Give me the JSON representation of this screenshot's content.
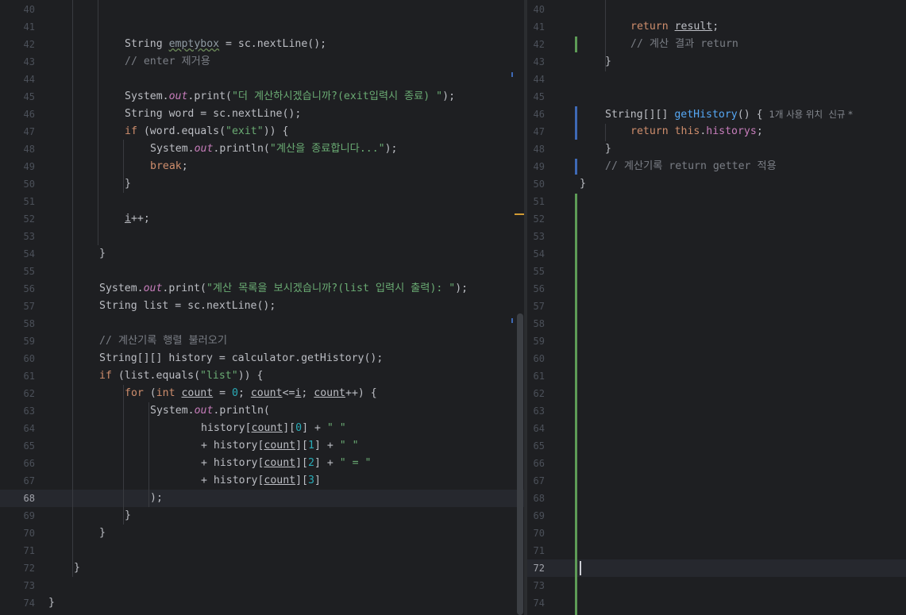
{
  "left_editor": {
    "current_line": 68,
    "lines": [
      {
        "n": 40,
        "tokens": []
      },
      {
        "n": 41,
        "tokens": []
      },
      {
        "n": 42,
        "tokens": [
          {
            "t": "String ",
            "c": ""
          },
          {
            "t": "emptybox",
            "c": "wv"
          },
          {
            "t": " = sc.nextLine();",
            "c": ""
          }
        ],
        "indent": 3
      },
      {
        "n": 43,
        "tokens": [
          {
            "t": "// enter 제거용",
            "c": "cm"
          }
        ],
        "indent": 3
      },
      {
        "n": 44,
        "tokens": []
      },
      {
        "n": 45,
        "tokens": [
          {
            "t": "System.",
            "c": ""
          },
          {
            "t": "out",
            "c": "fld"
          },
          {
            "t": ".print(",
            "c": ""
          },
          {
            "t": "\"더 계산하시겠습니까?(exit입력시 종료) \"",
            "c": "st"
          },
          {
            "t": ");",
            "c": ""
          }
        ],
        "indent": 3
      },
      {
        "n": 46,
        "tokens": [
          {
            "t": "String word = sc.nextLine();",
            "c": ""
          }
        ],
        "indent": 3
      },
      {
        "n": 47,
        "tokens": [
          {
            "t": "if ",
            "c": "kw"
          },
          {
            "t": "(word.equals(",
            "c": ""
          },
          {
            "t": "\"exit\"",
            "c": "st"
          },
          {
            "t": ")) {",
            "c": ""
          }
        ],
        "indent": 3
      },
      {
        "n": 48,
        "tokens": [
          {
            "t": "System.",
            "c": ""
          },
          {
            "t": "out",
            "c": "fld"
          },
          {
            "t": ".println(",
            "c": ""
          },
          {
            "t": "\"계산을 종료합니다...\"",
            "c": "st"
          },
          {
            "t": ");",
            "c": ""
          }
        ],
        "indent": 4
      },
      {
        "n": 49,
        "tokens": [
          {
            "t": "break",
            "c": "kw"
          },
          {
            "t": ";",
            "c": ""
          }
        ],
        "indent": 4
      },
      {
        "n": 50,
        "tokens": [
          {
            "t": "}",
            "c": ""
          }
        ],
        "indent": 3
      },
      {
        "n": 51,
        "tokens": []
      },
      {
        "n": 52,
        "tokens": [
          {
            "t": "i",
            "c": "ul"
          },
          {
            "t": "++;",
            "c": ""
          }
        ],
        "indent": 3
      },
      {
        "n": 53,
        "tokens": []
      },
      {
        "n": 54,
        "tokens": [
          {
            "t": "}",
            "c": ""
          }
        ],
        "indent": 2
      },
      {
        "n": 55,
        "tokens": []
      },
      {
        "n": 56,
        "tokens": [
          {
            "t": "System.",
            "c": ""
          },
          {
            "t": "out",
            "c": "fld"
          },
          {
            "t": ".print(",
            "c": ""
          },
          {
            "t": "\"계산 목록을 보시겠습니까?(list 입력시 출력): \"",
            "c": "st"
          },
          {
            "t": ");",
            "c": ""
          }
        ],
        "indent": 2
      },
      {
        "n": 57,
        "tokens": [
          {
            "t": "String list = sc.nextLine();",
            "c": ""
          }
        ],
        "indent": 2
      },
      {
        "n": 58,
        "tokens": []
      },
      {
        "n": 59,
        "tokens": [
          {
            "t": "// 계산기록 행렬 불러오기",
            "c": "cm"
          }
        ],
        "indent": 2
      },
      {
        "n": 60,
        "tokens": [
          {
            "t": "String[][] history = calculator.getHistory();",
            "c": ""
          }
        ],
        "indent": 2
      },
      {
        "n": 61,
        "tokens": [
          {
            "t": "if ",
            "c": "kw"
          },
          {
            "t": "(list.equals(",
            "c": ""
          },
          {
            "t": "\"list\"",
            "c": "st"
          },
          {
            "t": ")) {",
            "c": ""
          }
        ],
        "indent": 2
      },
      {
        "n": 62,
        "tokens": [
          {
            "t": "for ",
            "c": "kw"
          },
          {
            "t": "(",
            "c": ""
          },
          {
            "t": "int ",
            "c": "kw"
          },
          {
            "t": "count",
            "c": "ul"
          },
          {
            "t": " = ",
            "c": ""
          },
          {
            "t": "0",
            "c": "num"
          },
          {
            "t": "; ",
            "c": ""
          },
          {
            "t": "count",
            "c": "ul"
          },
          {
            "t": "<=",
            "c": ""
          },
          {
            "t": "i",
            "c": "ul"
          },
          {
            "t": "; ",
            "c": ""
          },
          {
            "t": "count",
            "c": "ul"
          },
          {
            "t": "++) {",
            "c": ""
          }
        ],
        "indent": 3
      },
      {
        "n": 63,
        "tokens": [
          {
            "t": "System.",
            "c": ""
          },
          {
            "t": "out",
            "c": "fld"
          },
          {
            "t": ".println(",
            "c": ""
          }
        ],
        "indent": 4
      },
      {
        "n": 64,
        "tokens": [
          {
            "t": "history[",
            "c": ""
          },
          {
            "t": "count",
            "c": "ul"
          },
          {
            "t": "][",
            "c": ""
          },
          {
            "t": "0",
            "c": "num"
          },
          {
            "t": "] + ",
            "c": ""
          },
          {
            "t": "\" \"",
            "c": "st"
          }
        ],
        "indent": 6
      },
      {
        "n": 65,
        "tokens": [
          {
            "t": "+ history[",
            "c": ""
          },
          {
            "t": "count",
            "c": "ul"
          },
          {
            "t": "][",
            "c": ""
          },
          {
            "t": "1",
            "c": "num"
          },
          {
            "t": "] + ",
            "c": ""
          },
          {
            "t": "\" \"",
            "c": "st"
          }
        ],
        "indent": 6
      },
      {
        "n": 66,
        "tokens": [
          {
            "t": "+ history[",
            "c": ""
          },
          {
            "t": "count",
            "c": "ul"
          },
          {
            "t": "][",
            "c": ""
          },
          {
            "t": "2",
            "c": "num"
          },
          {
            "t": "] + ",
            "c": ""
          },
          {
            "t": "\" = \"",
            "c": "st"
          }
        ],
        "indent": 6
      },
      {
        "n": 67,
        "tokens": [
          {
            "t": "+ history[",
            "c": ""
          },
          {
            "t": "count",
            "c": "ul"
          },
          {
            "t": "][",
            "c": ""
          },
          {
            "t": "3",
            "c": "num"
          },
          {
            "t": "]",
            "c": ""
          }
        ],
        "indent": 6
      },
      {
        "n": 68,
        "tokens": [
          {
            "t": ");",
            "c": ""
          }
        ],
        "indent": 4
      },
      {
        "n": 69,
        "tokens": [
          {
            "t": "}",
            "c": ""
          }
        ],
        "indent": 3
      },
      {
        "n": 70,
        "tokens": [
          {
            "t": "}",
            "c": ""
          }
        ],
        "indent": 2
      },
      {
        "n": 71,
        "tokens": []
      },
      {
        "n": 72,
        "tokens": [
          {
            "t": "}",
            "c": ""
          }
        ],
        "indent": 1
      },
      {
        "n": 73,
        "tokens": []
      },
      {
        "n": 74,
        "tokens": [
          {
            "t": "}",
            "c": ""
          }
        ],
        "indent": 0
      }
    ]
  },
  "right_editor": {
    "current_line": 72,
    "inlay_hint": "1개 사용 위치  신규 *",
    "lines": [
      {
        "n": 40,
        "tokens": []
      },
      {
        "n": 41,
        "tokens": [
          {
            "t": "return ",
            "c": "kw"
          },
          {
            "t": "result",
            "c": "ul"
          },
          {
            "t": ";",
            "c": ""
          }
        ],
        "indent": 2
      },
      {
        "n": 42,
        "tokens": [
          {
            "t": "// 계산 결과 return",
            "c": "cm"
          }
        ],
        "indent": 2
      },
      {
        "n": 43,
        "tokens": [
          {
            "t": "}",
            "c": ""
          }
        ],
        "indent": 1
      },
      {
        "n": 44,
        "tokens": []
      },
      {
        "n": 45,
        "tokens": []
      },
      {
        "n": 46,
        "tokens": [
          {
            "t": "String[][] ",
            "c": ""
          },
          {
            "t": "getHistory",
            "c": "fn"
          },
          {
            "t": "() {",
            "c": ""
          }
        ],
        "indent": 1,
        "hint": true
      },
      {
        "n": 47,
        "tokens": [
          {
            "t": "return ",
            "c": "kw"
          },
          {
            "t": "this",
            "c": "kw"
          },
          {
            "t": ".",
            "c": ""
          },
          {
            "t": "historys",
            "c": "ifld"
          },
          {
            "t": ";",
            "c": ""
          }
        ],
        "indent": 2
      },
      {
        "n": 48,
        "tokens": [
          {
            "t": "}",
            "c": ""
          }
        ],
        "indent": 1
      },
      {
        "n": 49,
        "tokens": [
          {
            "t": "// 계산기록 return getter 적용",
            "c": "cm"
          }
        ],
        "indent": 1
      },
      {
        "n": 50,
        "tokens": [
          {
            "t": "}",
            "c": ""
          }
        ],
        "indent": 0
      },
      {
        "n": 51,
        "tokens": []
      },
      {
        "n": 52,
        "tokens": []
      },
      {
        "n": 53,
        "tokens": []
      },
      {
        "n": 54,
        "tokens": []
      },
      {
        "n": 55,
        "tokens": []
      },
      {
        "n": 56,
        "tokens": []
      },
      {
        "n": 57,
        "tokens": []
      },
      {
        "n": 58,
        "tokens": []
      },
      {
        "n": 59,
        "tokens": []
      },
      {
        "n": 60,
        "tokens": []
      },
      {
        "n": 61,
        "tokens": []
      },
      {
        "n": 62,
        "tokens": []
      },
      {
        "n": 63,
        "tokens": []
      },
      {
        "n": 64,
        "tokens": []
      },
      {
        "n": 65,
        "tokens": []
      },
      {
        "n": 66,
        "tokens": []
      },
      {
        "n": 67,
        "tokens": []
      },
      {
        "n": 68,
        "tokens": []
      },
      {
        "n": 69,
        "tokens": []
      },
      {
        "n": 70,
        "tokens": []
      },
      {
        "n": 71,
        "tokens": []
      },
      {
        "n": 72,
        "tokens": []
      },
      {
        "n": 73,
        "tokens": []
      },
      {
        "n": 74,
        "tokens": []
      }
    ]
  },
  "colors": {
    "background": "#1e1f22",
    "keyword": "#cf8e6d",
    "string": "#6aab73",
    "comment": "#7a7e85",
    "number": "#2aacb8",
    "static_field": "#c77dbb",
    "method_decl": "#56a8f5",
    "vcs_added": "#5d9b56",
    "vcs_modified": "#3e69b5",
    "warning_marker": "#d19b34"
  }
}
